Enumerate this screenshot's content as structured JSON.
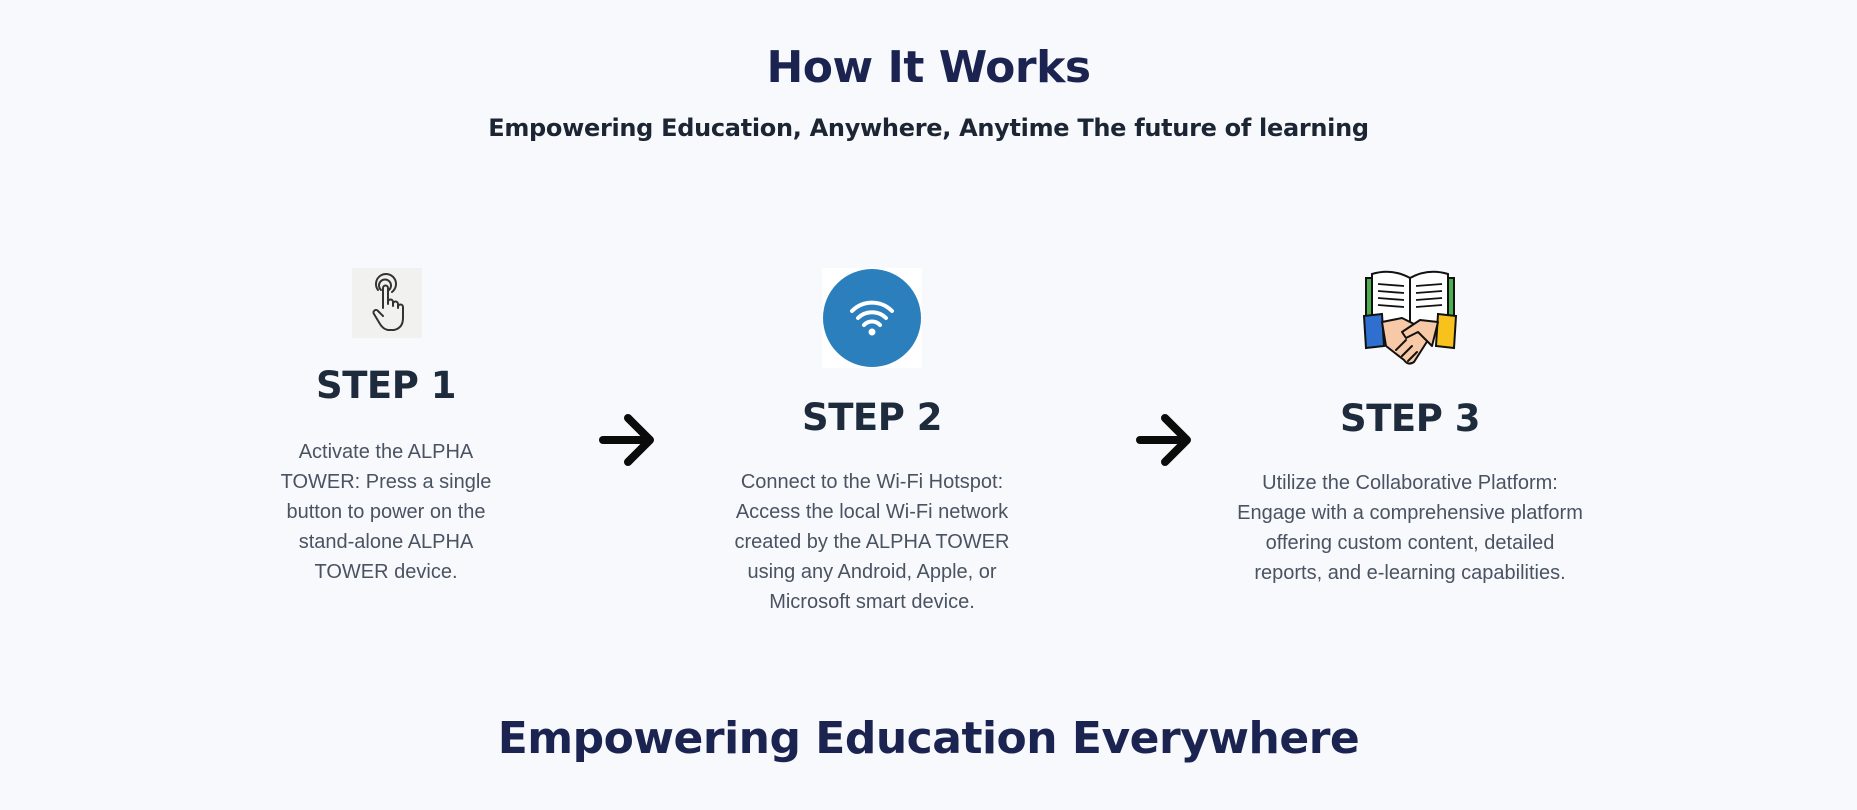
{
  "header": {
    "title": "How It Works",
    "subtitle": "Empowering Education, Anywhere, Anytime The future of learning"
  },
  "steps": [
    {
      "icon": "touch-hand-icon",
      "title": "STEP 1",
      "description": "Activate the ALPHA TOWER: Press a single button to power on the stand-alone ALPHA TOWER device."
    },
    {
      "icon": "wifi-icon",
      "title": "STEP 2",
      "description": "Connect to the Wi-Fi Hotspot: Access the local Wi-Fi network created by the ALPHA TOWER using any Android, Apple, or Microsoft smart device."
    },
    {
      "icon": "book-handshake-icon",
      "title": "STEP 3",
      "description": "Utilize the Collaborative Platform: Engage with a comprehensive platform offering custom content, detailed reports, and e-learning capabilities."
    }
  ],
  "arrows": [
    "arrow-right-icon",
    "arrow-right-icon"
  ],
  "next_section": {
    "title": "Empowering Education Everywhere"
  },
  "colors": {
    "background": "#f8f9fc",
    "heading": "#1b2350",
    "wifi_circle": "#2b7fbd"
  }
}
